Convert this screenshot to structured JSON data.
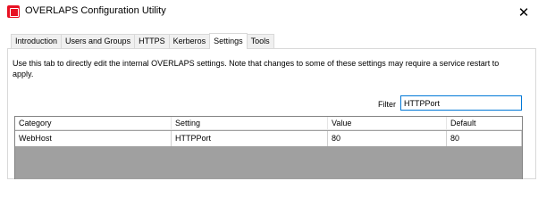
{
  "window": {
    "title": "OVERLAPS Configuration Utility",
    "close_glyph": "✕"
  },
  "tabs": [
    {
      "label": "Introduction"
    },
    {
      "label": "Users and Groups"
    },
    {
      "label": "HTTPS"
    },
    {
      "label": "Kerberos"
    },
    {
      "label": "Settings",
      "active": true
    },
    {
      "label": "Tools"
    }
  ],
  "settings": {
    "description": "Use this tab to directly edit the internal OVERLAPS settings. Note that changes to some of these settings may require a service restart to apply.",
    "filter_label": "Filter",
    "filter_value": "HTTPPort"
  },
  "grid": {
    "columns": [
      "Category",
      "Setting",
      "Value",
      "Default"
    ],
    "rows": [
      [
        "WebHost",
        "HTTPPort",
        "80",
        "80"
      ]
    ]
  },
  "colors": {
    "accent": "#0078d7",
    "grid_background": "#a0a0a0",
    "app_icon": "#e81123"
  }
}
